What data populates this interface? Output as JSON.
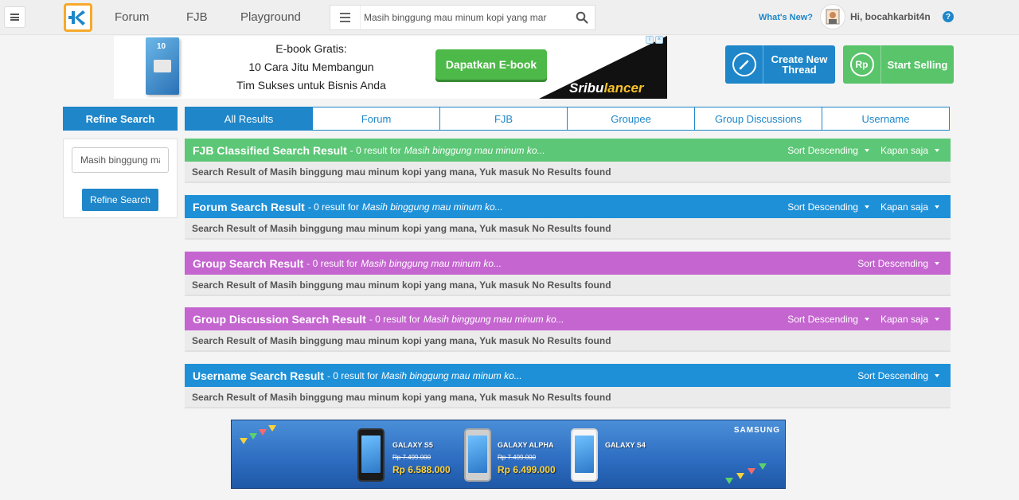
{
  "header": {
    "nav": [
      {
        "label": "Forum"
      },
      {
        "label": "FJB"
      },
      {
        "label": "Playground"
      }
    ],
    "search": {
      "value": "Masih binggung mau minum kopi yang mar"
    },
    "whats_new": "What's New?",
    "greeting": "Hi, bocahkarbit4n",
    "help": "?"
  },
  "ad_banner": {
    "line1": "E-book Gratis:",
    "line2": "10 Cara Jitu Membangun",
    "line3": "Tim Sukses untuk Bisnis Anda",
    "cta": "Dapatkan E-book",
    "brand_a": "Sribu",
    "brand_b": "lancer",
    "cover_number": "10",
    "badge_i": "i",
    "badge_x": "×"
  },
  "actions": {
    "create": {
      "line1": "Create New",
      "line2": "Thread"
    },
    "sell": {
      "label": "Start Selling",
      "icon_text": "Rp"
    }
  },
  "sidebar": {
    "title": "Refine Search",
    "input_value": "Masih binggung mau minum kopi yang mana, Yuk masuk",
    "button": "Refine Search"
  },
  "tabs": [
    {
      "label": "All Results",
      "active": true
    },
    {
      "label": "Forum"
    },
    {
      "label": "FJB"
    },
    {
      "label": "Groupee"
    },
    {
      "label": "Group Discussions"
    },
    {
      "label": "Username"
    }
  ],
  "results": [
    {
      "title": "FJB Classified Search Result",
      "count_text": "- 0 result for",
      "query": "Masih binggung mau minum ko...",
      "sort": "Sort Descending",
      "time": "Kapan saja",
      "body": "Search Result of Masih binggung mau minum kopi yang mana, Yuk masuk No Results found",
      "color": "#5cc776"
    },
    {
      "title": "Forum Search Result",
      "count_text": "- 0 result for",
      "query": "Masih binggung mau minum ko...",
      "sort": "Sort Descending",
      "time": "Kapan saja",
      "body": "Search Result of Masih binggung mau minum kopi yang mana, Yuk masuk No Results found",
      "color": "#1e90d8"
    },
    {
      "title": "Group Search Result",
      "count_text": "- 0 result for",
      "query": "Masih binggung mau minum ko...",
      "sort": "Sort Descending",
      "body": "Search Result of Masih binggung mau minum kopi yang mana, Yuk masuk No Results found",
      "color": "#c565d0"
    },
    {
      "title": "Group Discussion Search Result",
      "count_text": "- 0 result for",
      "query": "Masih binggung mau minum ko...",
      "sort": "Sort Descending",
      "time": "Kapan saja",
      "body": "Search Result of Masih binggung mau minum kopi yang mana, Yuk masuk No Results found",
      "color": "#c565d0"
    },
    {
      "title": "Username Search Result",
      "count_text": "- 0 result for",
      "query": "Masih binggung mau minum ko...",
      "sort": "Sort Descending",
      "body": "Search Result of Masih binggung mau minum kopi yang mana, Yuk masuk No Results found",
      "color": "#1e90d8"
    }
  ],
  "ad_samsung": {
    "brand": "SAMSUNG",
    "phones": [
      {
        "model": "GALAXY S5",
        "old_price": "Rp 7.499.000",
        "new_price": "Rp 6.588.000"
      },
      {
        "model": "GALAXY ALPHA",
        "old_price": "Rp 7.499.000",
        "new_price": "Rp 6.499.000"
      },
      {
        "model": "GALAXY S4"
      }
    ]
  },
  "colors": {
    "accent": "#1e86c9",
    "green": "#5cc776",
    "purple": "#c565d0",
    "logo_orange": "#f7a92b"
  }
}
